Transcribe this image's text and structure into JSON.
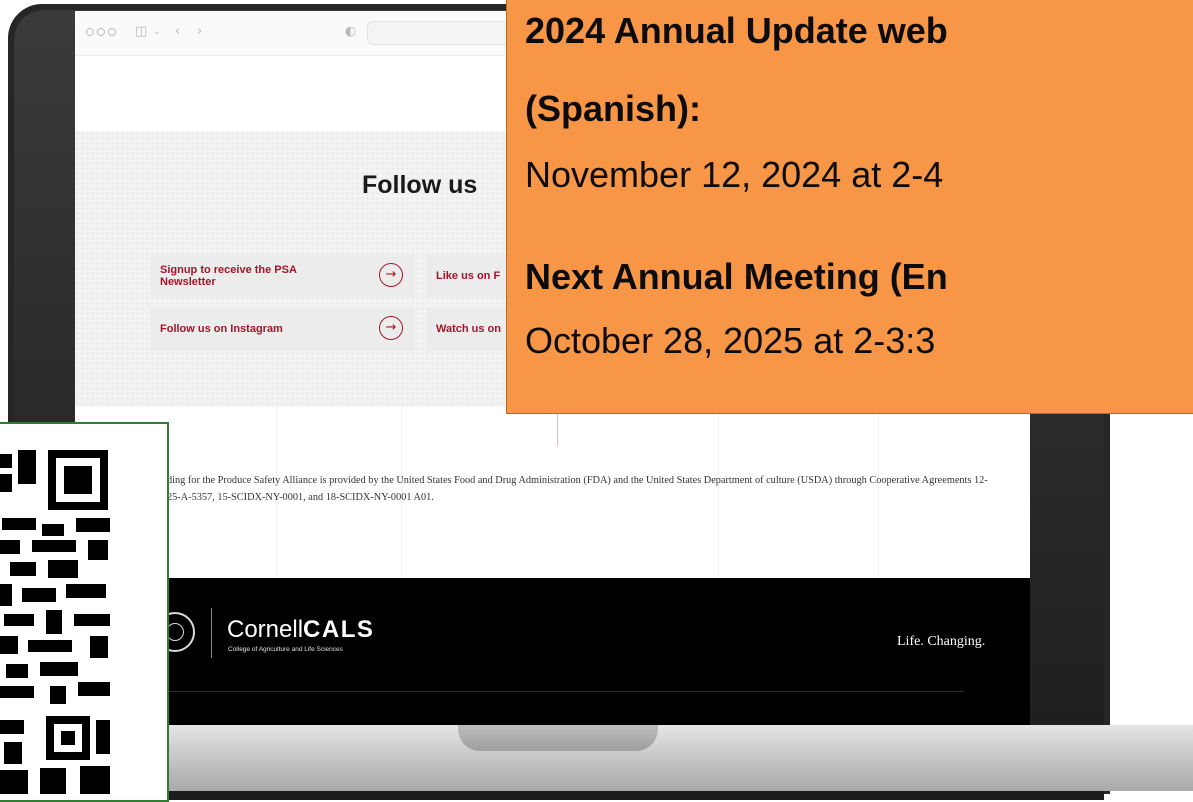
{
  "browser": {
    "back_icon": "chevron-left-icon",
    "forward_icon": "chevron-right-icon",
    "sidebar_icon": "sidebar-icon",
    "shield_icon": "shield-icon"
  },
  "page": {
    "follow_heading": "Follow us",
    "links": [
      {
        "label": "Signup to receive the PSA Newsletter",
        "icon": "arrow-right-circle-icon"
      },
      {
        "label": "Like us on F",
        "icon": "arrow-right-circle-icon"
      },
      {
        "label": "Follow us on Instagram",
        "icon": "arrow-right-circle-icon"
      },
      {
        "label": "Watch us on",
        "icon": "arrow-right-circle-icon"
      }
    ],
    "funding_text": "ding for the Produce Safety Alliance is provided by the United States Food and Drug Administration (FDA) and the United States Department of culture (USDA) through Cooperative Agreements 12-25-A-5357, 15-SCIDX-NY-0001, and 18-SCIDX-NY-0001 A01."
  },
  "footer": {
    "brand_light": "Cornell",
    "brand_bold": "CALS",
    "brand_sub": "College of Agriculture and Life Sciences",
    "tagline": "Life. Changing."
  },
  "overlay": {
    "line1": "2024 Annual Update web",
    "line2": "(Spanish):",
    "line3": "November 12, 2024 at 2-4",
    "line4": "Next Annual Meeting (En",
    "line5": "October 28, 2025 at 2-3:3",
    "bg_color": "#f79646"
  },
  "qr": {
    "border_color": "#2e7d32"
  }
}
